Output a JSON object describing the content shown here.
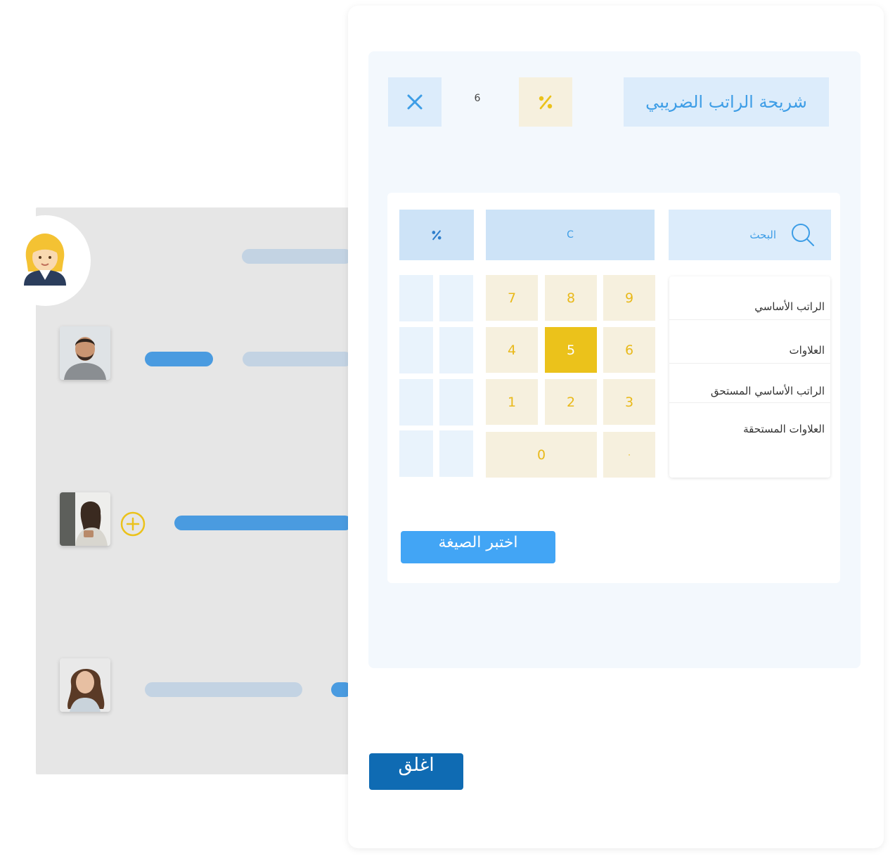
{
  "formula": {
    "title": "شريحة الراتب الضريبي",
    "value": "6",
    "percent_icon": "percent-icon",
    "close_icon": "close-icon"
  },
  "calculator": {
    "search_placeholder": "البحث",
    "clear_label": "C",
    "percent_icon": "percent-icon",
    "keys": {
      "k9": "9",
      "k8": "8",
      "k7": "7",
      "k6": "6",
      "k5": "5",
      "k4": "4",
      "k3": "3",
      "k2": "2",
      "k1": "1",
      "dot": "·",
      "k0": "0"
    },
    "active_key": "5",
    "variables": [
      "الراتب الأساسي",
      "العلاوات",
      "الراتب الأساسي المستحق",
      "العلاوات المستحقة"
    ],
    "choose_formula_label": "اختبر الصيغة"
  },
  "modal": {
    "close_label": "اغلق"
  },
  "colors": {
    "primary": "#42a5f5",
    "primary_dark": "#0f6bb3",
    "accent": "#ebc21b",
    "key_bg": "#f6f0de",
    "panel_bg": "#f3f8fd"
  }
}
